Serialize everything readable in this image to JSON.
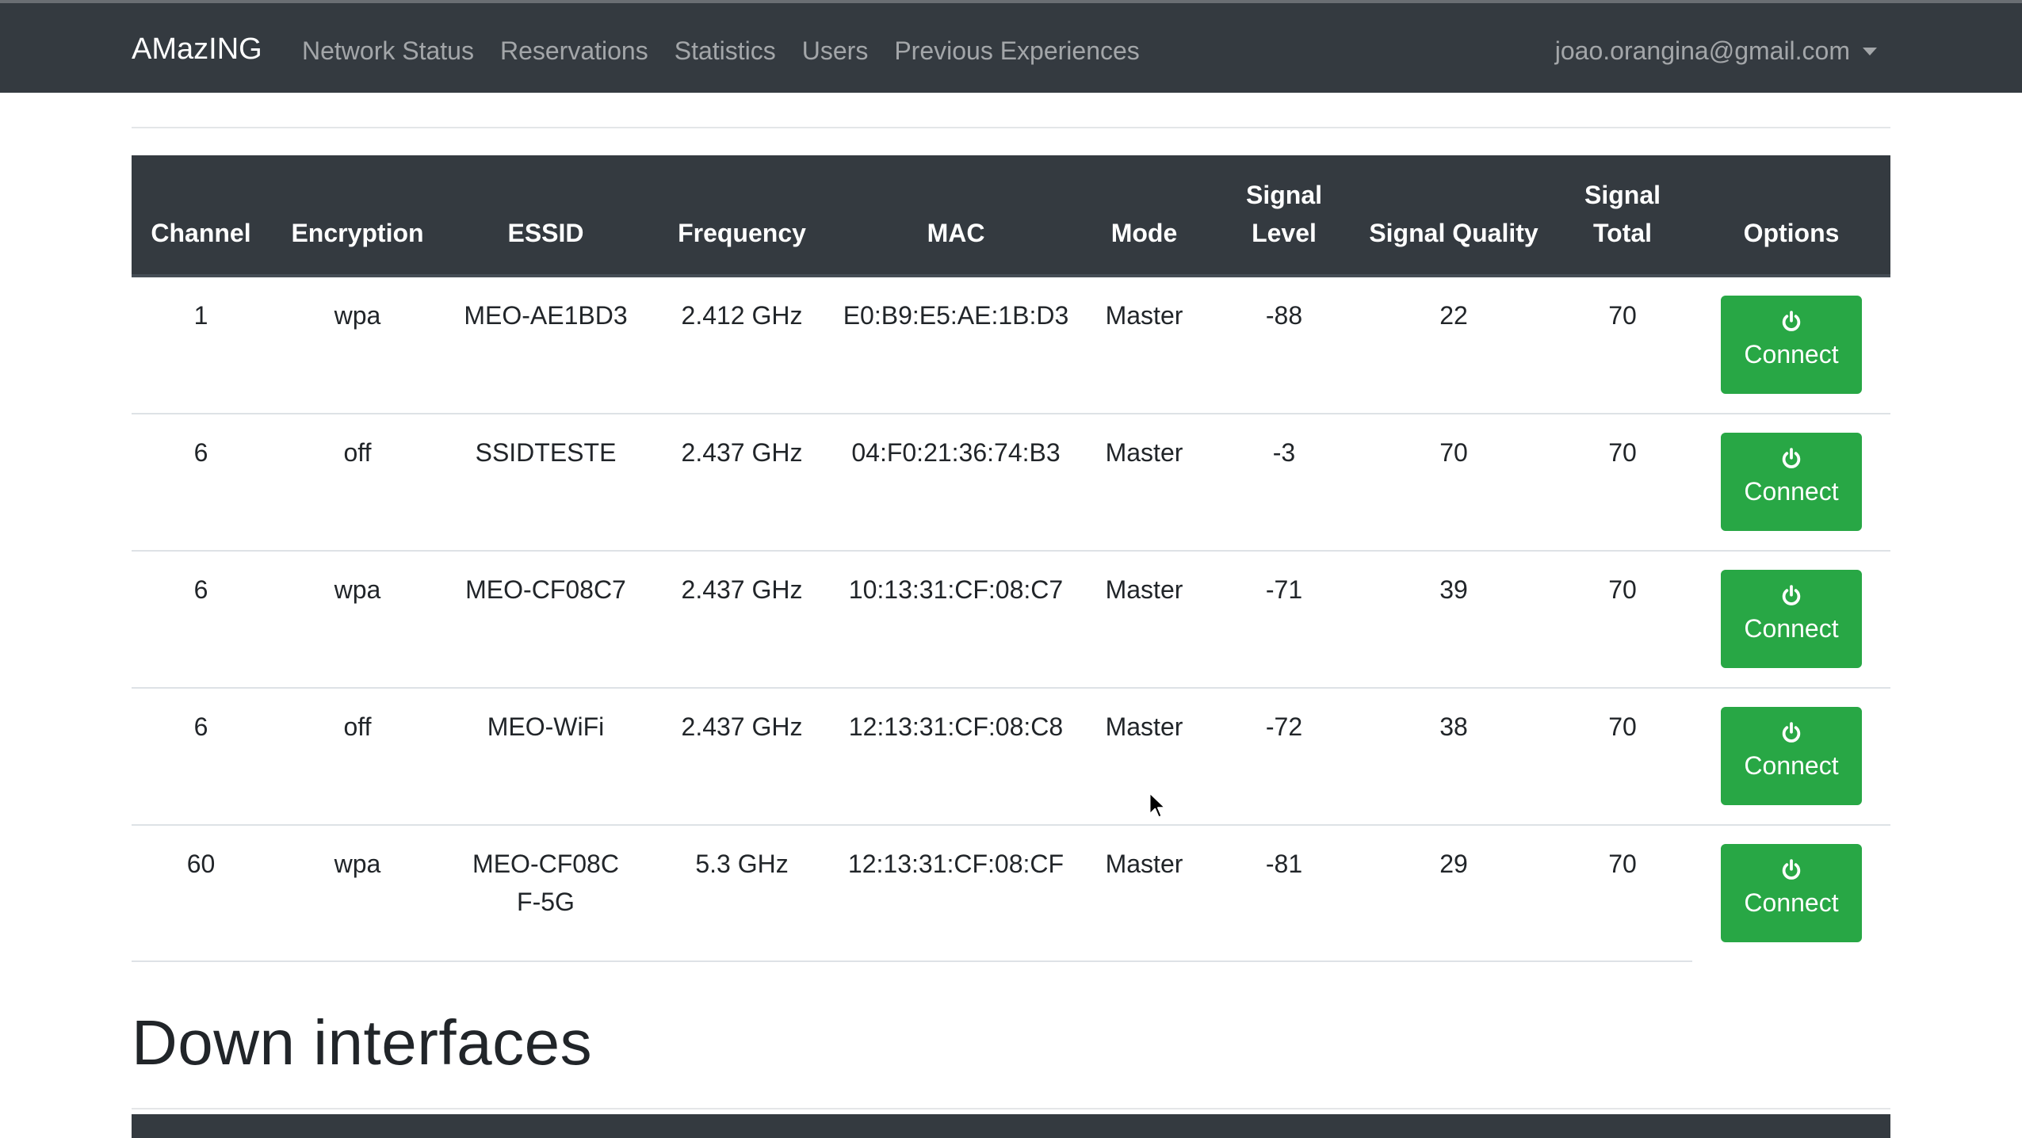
{
  "navbar": {
    "brand": "AMazING",
    "links": [
      "Network Status",
      "Reservations",
      "Statistics",
      "Users",
      "Previous Experiences"
    ],
    "user_email": "joao.orangina@gmail.com"
  },
  "table": {
    "headers": [
      "Channel",
      "Encryption",
      "ESSID",
      "Frequency",
      "MAC",
      "Mode",
      "Signal Level",
      "Signal Quality",
      "Signal Total",
      "Options"
    ],
    "rows": [
      {
        "channel": "1",
        "encryption": "wpa",
        "essid": "MEO-AE1BD3",
        "frequency": "2.412 GHz",
        "mac": "E0:B9:E5:AE:1B:D3",
        "mode": "Master",
        "signal_level": "-88",
        "signal_quality": "22",
        "signal_total": "70",
        "action": "Connect"
      },
      {
        "channel": "6",
        "encryption": "off",
        "essid": "SSIDTESTE",
        "frequency": "2.437 GHz",
        "mac": "04:F0:21:36:74:B3",
        "mode": "Master",
        "signal_level": "-3",
        "signal_quality": "70",
        "signal_total": "70",
        "action": "Connect"
      },
      {
        "channel": "6",
        "encryption": "wpa",
        "essid": "MEO-CF08C7",
        "frequency": "2.437 GHz",
        "mac": "10:13:31:CF:08:C7",
        "mode": "Master",
        "signal_level": "-71",
        "signal_quality": "39",
        "signal_total": "70",
        "action": "Connect"
      },
      {
        "channel": "6",
        "encryption": "off",
        "essid": "MEO-WiFi",
        "frequency": "2.437 GHz",
        "mac": "12:13:31:CF:08:C8",
        "mode": "Master",
        "signal_level": "-72",
        "signal_quality": "38",
        "signal_total": "70",
        "action": "Connect"
      },
      {
        "channel": "60",
        "encryption": "wpa",
        "essid": "MEO-CF08CF-5G",
        "frequency": "5.3 GHz",
        "mac": "12:13:31:CF:08:CF",
        "mode": "Master",
        "signal_level": "-81",
        "signal_quality": "29",
        "signal_total": "70",
        "action": "Connect"
      }
    ]
  },
  "down_section": {
    "title": "Down interfaces"
  },
  "icons": {
    "connect": "power-icon",
    "user_menu": "caret-down-icon",
    "cursor": "mouse-pointer-icon"
  },
  "colors": {
    "navbar_bg": "#343a40",
    "success": "#28a745",
    "text": "#212529"
  }
}
